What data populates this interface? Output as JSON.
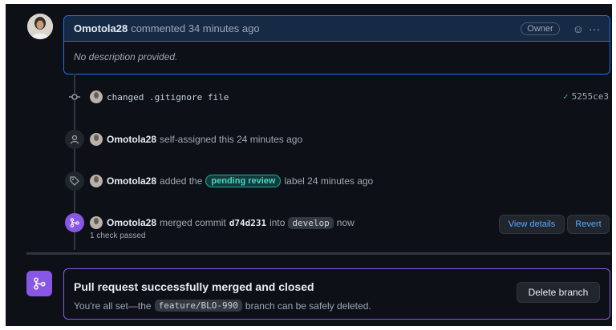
{
  "comment": {
    "author": "Omotola28",
    "meta": "commented 34 minutes ago",
    "owner_badge": "Owner",
    "emoji_icon": "☺",
    "more_icon": "···",
    "body": "No description provided."
  },
  "timeline": {
    "commit": {
      "message": "changed .gitignore file",
      "check": "✓",
      "sha": "5255ce3"
    },
    "assigned": {
      "author": "Omotola28",
      "text": "self-assigned this 24 minutes ago"
    },
    "labeled": {
      "author": "Omotola28",
      "text_before": "added the",
      "label": "pending review",
      "text_after": "label 24 minutes ago"
    },
    "merged": {
      "author": "Omotola28",
      "text_before": "merged commit",
      "commit_sha": "d74d231",
      "text_into": "into",
      "branch": "develop",
      "text_after": "now",
      "checks": "1 check passed",
      "view_details": "View details",
      "revert": "Revert"
    }
  },
  "merge_box": {
    "title": "Pull request successfully merged and closed",
    "sub_before": "You're all set—the",
    "branch": "feature/BLO-990",
    "sub_after": "branch can be safely deleted.",
    "delete_label": "Delete branch"
  },
  "colors": {
    "background": "#0d1117",
    "accent_blue": "#1f6feb",
    "merged_purple": "#8957e5",
    "label_teal": "#2ea8a0",
    "success_green": "#3fb950"
  }
}
